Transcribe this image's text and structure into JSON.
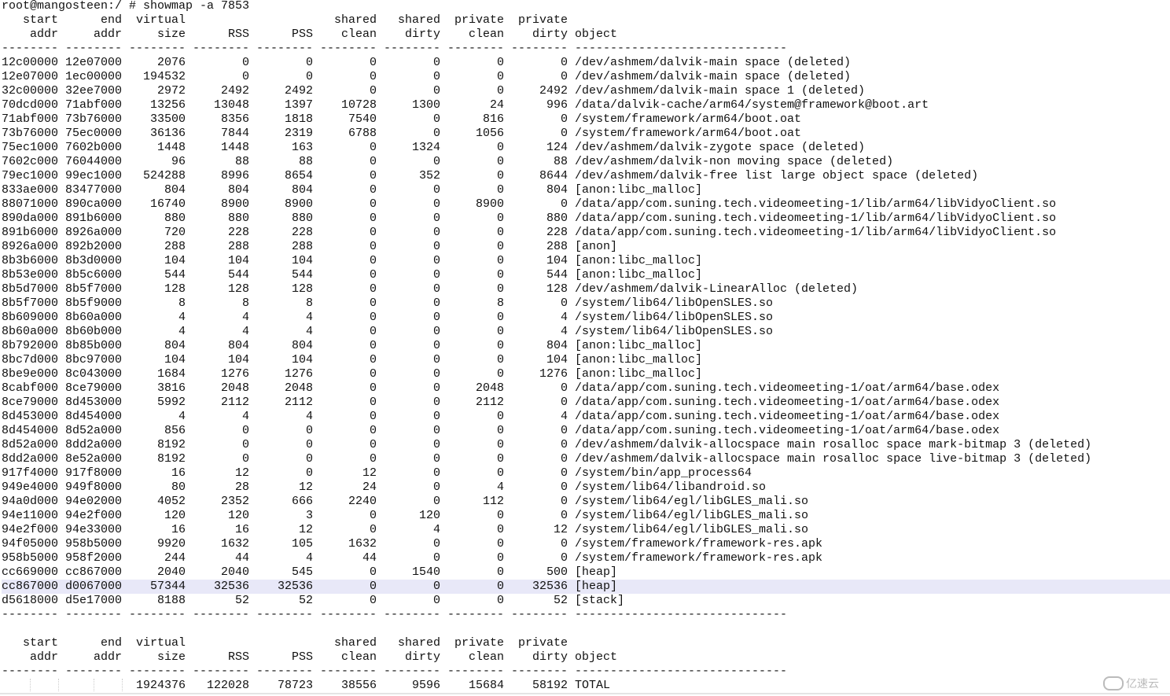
{
  "command": "root@mangosteen:/ # showmap -a 7853",
  "header": {
    "line1": [
      "start",
      "end",
      "virtual",
      "",
      "",
      "shared",
      "shared",
      "private",
      "private",
      ""
    ],
    "line2": [
      "addr",
      "addr",
      "size",
      "RSS",
      "PSS",
      "clean",
      "dirty",
      "clean",
      "dirty",
      "object"
    ]
  },
  "dashes": "--------",
  "object_dashes": "------------------------------",
  "rows": [
    [
      "12c00000",
      "12e07000",
      "2076",
      "0",
      "0",
      "0",
      "0",
      "0",
      "0",
      "/dev/ashmem/dalvik-main space (deleted)"
    ],
    [
      "12e07000",
      "1ec00000",
      "194532",
      "0",
      "0",
      "0",
      "0",
      "0",
      "0",
      "/dev/ashmem/dalvik-main space (deleted)"
    ],
    [
      "32c00000",
      "32ee7000",
      "2972",
      "2492",
      "2492",
      "0",
      "0",
      "0",
      "2492",
      "/dev/ashmem/dalvik-main space 1 (deleted)"
    ],
    [
      "70dcd000",
      "71abf000",
      "13256",
      "13048",
      "1397",
      "10728",
      "1300",
      "24",
      "996",
      "/data/dalvik-cache/arm64/system@framework@boot.art"
    ],
    [
      "71abf000",
      "73b76000",
      "33500",
      "8356",
      "1818",
      "7540",
      "0",
      "816",
      "0",
      "/system/framework/arm64/boot.oat"
    ],
    [
      "73b76000",
      "75ec0000",
      "36136",
      "7844",
      "2319",
      "6788",
      "0",
      "1056",
      "0",
      "/system/framework/arm64/boot.oat"
    ],
    [
      "75ec1000",
      "7602b000",
      "1448",
      "1448",
      "163",
      "0",
      "1324",
      "0",
      "124",
      "/dev/ashmem/dalvik-zygote space (deleted)"
    ],
    [
      "7602c000",
      "76044000",
      "96",
      "88",
      "88",
      "0",
      "0",
      "0",
      "88",
      "/dev/ashmem/dalvik-non moving space (deleted)"
    ],
    [
      "79ec1000",
      "99ec1000",
      "524288",
      "8996",
      "8654",
      "0",
      "352",
      "0",
      "8644",
      "/dev/ashmem/dalvik-free list large object space (deleted)"
    ],
    [
      "833ae000",
      "83477000",
      "804",
      "804",
      "804",
      "0",
      "0",
      "0",
      "804",
      "[anon:libc_malloc]"
    ],
    [
      "88071000",
      "890ca000",
      "16740",
      "8900",
      "8900",
      "0",
      "0",
      "8900",
      "0",
      "/data/app/com.suning.tech.videomeeting-1/lib/arm64/libVidyoClient.so"
    ],
    [
      "890da000",
      "891b6000",
      "880",
      "880",
      "880",
      "0",
      "0",
      "0",
      "880",
      "/data/app/com.suning.tech.videomeeting-1/lib/arm64/libVidyoClient.so"
    ],
    [
      "891b6000",
      "8926a000",
      "720",
      "228",
      "228",
      "0",
      "0",
      "0",
      "228",
      "/data/app/com.suning.tech.videomeeting-1/lib/arm64/libVidyoClient.so"
    ],
    [
      "8926a000",
      "892b2000",
      "288",
      "288",
      "288",
      "0",
      "0",
      "0",
      "288",
      "[anon]"
    ],
    [
      "8b3b6000",
      "8b3d0000",
      "104",
      "104",
      "104",
      "0",
      "0",
      "0",
      "104",
      "[anon:libc_malloc]"
    ],
    [
      "8b53e000",
      "8b5c6000",
      "544",
      "544",
      "544",
      "0",
      "0",
      "0",
      "544",
      "[anon:libc_malloc]"
    ],
    [
      "8b5d7000",
      "8b5f7000",
      "128",
      "128",
      "128",
      "0",
      "0",
      "0",
      "128",
      "/dev/ashmem/dalvik-LinearAlloc (deleted)"
    ],
    [
      "8b5f7000",
      "8b5f9000",
      "8",
      "8",
      "8",
      "0",
      "0",
      "8",
      "0",
      "/system/lib64/libOpenSLES.so"
    ],
    [
      "8b609000",
      "8b60a000",
      "4",
      "4",
      "4",
      "0",
      "0",
      "0",
      "4",
      "/system/lib64/libOpenSLES.so"
    ],
    [
      "8b60a000",
      "8b60b000",
      "4",
      "4",
      "4",
      "0",
      "0",
      "0",
      "4",
      "/system/lib64/libOpenSLES.so"
    ],
    [
      "8b792000",
      "8b85b000",
      "804",
      "804",
      "804",
      "0",
      "0",
      "0",
      "804",
      "[anon:libc_malloc]"
    ],
    [
      "8bc7d000",
      "8bc97000",
      "104",
      "104",
      "104",
      "0",
      "0",
      "0",
      "104",
      "[anon:libc_malloc]"
    ],
    [
      "8be9e000",
      "8c043000",
      "1684",
      "1276",
      "1276",
      "0",
      "0",
      "0",
      "1276",
      "[anon:libc_malloc]"
    ],
    [
      "8cabf000",
      "8ce79000",
      "3816",
      "2048",
      "2048",
      "0",
      "0",
      "2048",
      "0",
      "/data/app/com.suning.tech.videomeeting-1/oat/arm64/base.odex"
    ],
    [
      "8ce79000",
      "8d453000",
      "5992",
      "2112",
      "2112",
      "0",
      "0",
      "2112",
      "0",
      "/data/app/com.suning.tech.videomeeting-1/oat/arm64/base.odex"
    ],
    [
      "8d453000",
      "8d454000",
      "4",
      "4",
      "4",
      "0",
      "0",
      "0",
      "4",
      "/data/app/com.suning.tech.videomeeting-1/oat/arm64/base.odex"
    ],
    [
      "8d454000",
      "8d52a000",
      "856",
      "0",
      "0",
      "0",
      "0",
      "0",
      "0",
      "/data/app/com.suning.tech.videomeeting-1/oat/arm64/base.odex"
    ],
    [
      "8d52a000",
      "8dd2a000",
      "8192",
      "0",
      "0",
      "0",
      "0",
      "0",
      "0",
      "/dev/ashmem/dalvik-allocspace main rosalloc space mark-bitmap 3 (deleted)"
    ],
    [
      "8dd2a000",
      "8e52a000",
      "8192",
      "0",
      "0",
      "0",
      "0",
      "0",
      "0",
      "/dev/ashmem/dalvik-allocspace main rosalloc space live-bitmap 3 (deleted)"
    ],
    [
      "917f4000",
      "917f8000",
      "16",
      "12",
      "0",
      "12",
      "0",
      "0",
      "0",
      "/system/bin/app_process64"
    ],
    [
      "949e4000",
      "949f8000",
      "80",
      "28",
      "12",
      "24",
      "0",
      "4",
      "0",
      "/system/lib64/libandroid.so"
    ],
    [
      "94a0d000",
      "94e02000",
      "4052",
      "2352",
      "666",
      "2240",
      "0",
      "112",
      "0",
      "/system/lib64/egl/libGLES_mali.so"
    ],
    [
      "94e11000",
      "94e2f000",
      "120",
      "120",
      "3",
      "0",
      "120",
      "0",
      "0",
      "/system/lib64/egl/libGLES_mali.so"
    ],
    [
      "94e2f000",
      "94e33000",
      "16",
      "16",
      "12",
      "0",
      "4",
      "0",
      "12",
      "/system/lib64/egl/libGLES_mali.so"
    ],
    [
      "94f05000",
      "958b5000",
      "9920",
      "1632",
      "105",
      "1632",
      "0",
      "0",
      "0",
      "/system/framework/framework-res.apk"
    ],
    [
      "958b5000",
      "958f2000",
      "244",
      "44",
      "4",
      "44",
      "0",
      "0",
      "0",
      "/system/framework/framework-res.apk"
    ],
    [
      "cc669000",
      "cc867000",
      "2040",
      "2040",
      "545",
      "0",
      "1540",
      "0",
      "500",
      "[heap]"
    ],
    [
      "cc867000",
      "d0067000",
      "57344",
      "32536",
      "32536",
      "0",
      "0",
      "0",
      "32536",
      "[heap]"
    ],
    [
      "d5618000",
      "d5e17000",
      "8188",
      "52",
      "52",
      "0",
      "0",
      "0",
      "52",
      "[stack]"
    ]
  ],
  "highlighted_row": 37,
  "total": [
    "",
    "",
    "1924376",
    "122028",
    "78723",
    "38556",
    "9596",
    "15684",
    "58192",
    "TOTAL"
  ],
  "watermark": "亿速云",
  "colors": {
    "highlight": "#e8e8f8",
    "text": "#111111",
    "background": "#ffffff"
  }
}
